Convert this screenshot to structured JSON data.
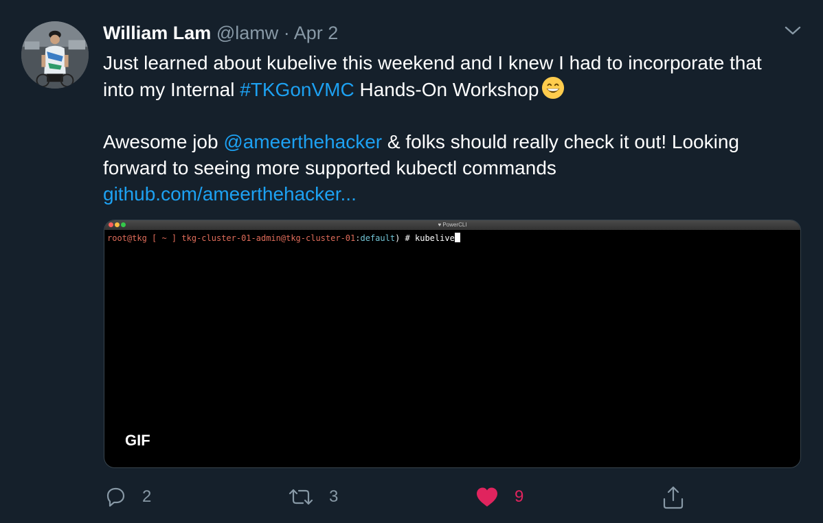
{
  "tweet": {
    "author_name": "William Lam",
    "handle": "@lamw",
    "separator": "·",
    "date": "Apr 2",
    "line1_pre": "Just learned about kubelive this weekend and I knew I had to incorporate that into my Internal ",
    "hashtag": "#TKGonVMC",
    "line1_post": " Hands-On Workshop",
    "emoji_icon": "grinning-face-emoji",
    "line2_pre": "Awesome job ",
    "mention": "@ameerthehacker",
    "line2_post": " & folks should really check it out!  Looking forward to seeing more supported kubectl commands",
    "url_text": "github.com/ameerthehacker..."
  },
  "media": {
    "window_title": "PowerCLI",
    "prompt_user": "root@tkg",
    "prompt_dir": "[ ~ ]",
    "prompt_context": "tkg-cluster-01-admin@tkg-cluster-01",
    "prompt_colon": ":",
    "prompt_namespace": "default",
    "prompt_end": ") #",
    "command": "kubelive",
    "badge": "GIF"
  },
  "actions": {
    "reply_count": "2",
    "retweet_count": "3",
    "like_count": "9"
  },
  "colors": {
    "background": "#15202b",
    "link": "#1da1f2",
    "muted": "#8899a6",
    "like": "#e0245e"
  }
}
